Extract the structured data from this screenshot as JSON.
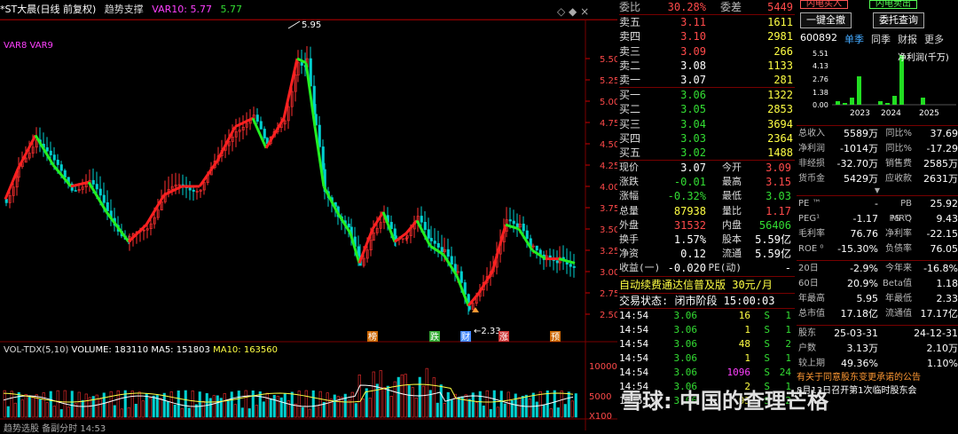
{
  "chart": {
    "title": "*ST大晨(日线 前复权)",
    "indicator_name": "趋势支撑",
    "var10": "VAR10: 5.77",
    "var10b": "5.77",
    "var8": "VAR8",
    "var9": "VAR9",
    "high_label": "5.95",
    "low_label": "2.33",
    "price_ticks": [
      "5.50",
      "5.25",
      "5.00",
      "4.75",
      "4.50",
      "4.25",
      "4.00",
      "3.75",
      "3.50",
      "3.25",
      "3.00",
      "2.75",
      "2.50"
    ],
    "markers": [
      "榜",
      "跌",
      "财",
      "涨",
      "预"
    ],
    "vol_header": {
      "name": "VOL-TDX(5,10)",
      "volume": "VOLUME: 183110",
      "ma5": "MA5: 151803",
      "ma10": "MA10: 163560"
    },
    "vol_ticks": [
      "10000",
      "5000",
      "X100"
    ],
    "bottom_text": "趋势选股   备副分时  14:53"
  },
  "order_book": {
    "ratio_label": "委比",
    "ratio_value": "30.28%",
    "diff_label": "委差",
    "diff_value": "5449",
    "asks": [
      {
        "label": "卖五",
        "price": "3.11",
        "vol": "1611"
      },
      {
        "label": "卖四",
        "price": "3.10",
        "vol": "2981"
      },
      {
        "label": "卖三",
        "price": "3.09",
        "vol": "266"
      },
      {
        "label": "卖二",
        "price": "3.08",
        "vol": "1133"
      },
      {
        "label": "卖一",
        "price": "3.07",
        "vol": "281"
      }
    ],
    "bids": [
      {
        "label": "买一",
        "price": "3.06",
        "vol": "1322"
      },
      {
        "label": "买二",
        "price": "3.05",
        "vol": "2853"
      },
      {
        "label": "买三",
        "price": "3.04",
        "vol": "3694"
      },
      {
        "label": "买四",
        "price": "3.03",
        "vol": "2364"
      },
      {
        "label": "买五",
        "price": "3.02",
        "vol": "1488"
      }
    ],
    "stats": [
      {
        "k1": "现价",
        "v1": "3.07",
        "k2": "今开",
        "v2": "3.09"
      },
      {
        "k1": "涨跌",
        "v1": "-0.01",
        "k2": "最高",
        "v2": "3.15"
      },
      {
        "k1": "涨幅",
        "v1": "-0.32%",
        "k2": "最低",
        "v2": "3.03"
      },
      {
        "k1": "总量",
        "v1": "87938",
        "k2": "量比",
        "v2": "1.17"
      },
      {
        "k1": "外盘",
        "v1": "31532",
        "k2": "内盘",
        "v2": "56406"
      },
      {
        "k1": "换手",
        "v1": "1.57%",
        "k2": "股本",
        "v2": "5.59亿"
      },
      {
        "k1": "净资",
        "v1": "0.12",
        "k2": "流通",
        "v2": "5.59亿"
      },
      {
        "k1": "收益(一)",
        "v1": "-0.020",
        "k2": "PE(动)",
        "v2": "-"
      }
    ],
    "ad_text": "自动续费通达信普及版  30元/月",
    "trade_status": "交易状态: 闭市阶段 15:00:03",
    "trades": [
      {
        "time": "14:54",
        "price": "3.06",
        "vol": "16",
        "side": "S",
        "n": "1"
      },
      {
        "time": "14:54",
        "price": "3.06",
        "vol": "1",
        "side": "S",
        "n": "1"
      },
      {
        "time": "14:54",
        "price": "3.06",
        "vol": "48",
        "side": "S",
        "n": "2"
      },
      {
        "time": "14:54",
        "price": "3.06",
        "vol": "1",
        "side": "S",
        "n": "1"
      },
      {
        "time": "14:54",
        "price": "3.06",
        "vol": "1096",
        "side": "S",
        "n": "24"
      },
      {
        "time": "14:54",
        "price": "3.06",
        "vol": "2",
        "side": "S",
        "n": "1"
      },
      {
        "time": "14:55",
        "price": "3.06",
        "vol": "93",
        "side": "S",
        "n": "2"
      }
    ]
  },
  "fin": {
    "btn1": "一键全撤",
    "btn2": "委托查询",
    "top_btn1": "闪电买入",
    "top_btn2": "闪电卖出",
    "code": "600892",
    "tabs": [
      "单季",
      "同季",
      "财报",
      "更多"
    ],
    "bar_title": "净利润(千万)",
    "bar_ticks": [
      "5.51",
      "4.13",
      "2.76",
      "1.38",
      "0.00"
    ],
    "bar_years": [
      "2023",
      "2024",
      "2025"
    ],
    "rows1": [
      {
        "k": "总收入",
        "v": "5589万",
        "k2": "同比%",
        "v2": "37.69"
      },
      {
        "k": "净利润",
        "v": "-1014万",
        "k2": "同比%",
        "v2": "-17.29"
      },
      {
        "k": "非经损",
        "v": "-32.70万",
        "k2": "销售费",
        "v2": "2585万"
      },
      {
        "k": "货币金",
        "v": "5429万",
        "k2": "应收款",
        "v2": "2631万"
      }
    ],
    "rows2": [
      {
        "k": "PE ™",
        "v": "-",
        "k2": "PB MRQ",
        "v2": "25.92"
      },
      {
        "k": "PEG¹",
        "v": "-1.17",
        "k2": "PS ™",
        "v2": "9.43"
      },
      {
        "k": "毛利率",
        "v": "76.76",
        "k2": "净利率",
        "v2": "-22.15"
      },
      {
        "k": "ROE ⁰",
        "v": "-15.30%",
        "k2": "负债率",
        "v2": "76.05"
      }
    ],
    "rows3": [
      {
        "k": "20日",
        "v": "-2.9%",
        "k2": "今年来",
        "v2": "-16.8%"
      },
      {
        "k": "60日",
        "v": "20.9%",
        "k2": "Beta值",
        "v2": "1.18"
      },
      {
        "k": "年最高",
        "v": "5.95",
        "k2": "年最低",
        "v2": "2.33"
      },
      {
        "k": "总市值",
        "v": "17.18亿",
        "k2": "流通值",
        "v2": "17.17亿"
      }
    ],
    "rows4": [
      {
        "k": "股东",
        "v": "25-03-31",
        "k2": "",
        "v2": "24-12-31"
      },
      {
        "k": "户数",
        "v": "3.13万",
        "k2": "",
        "v2": "2.10万"
      },
      {
        "k": "较上期",
        "v": "49.36%",
        "k2": "",
        "v2": "1.10%"
      }
    ],
    "news1": "有关于同意股东变更承诺的公告",
    "news2": "8月13日召开第1次临时股东会"
  },
  "watermark": "雪球: 中国的查理芒格",
  "colors": {
    "up": "#ff3030",
    "down": "#00d0d0",
    "line_up": "#ff2020",
    "line_down": "#22ee22",
    "grid": "#7a0000"
  }
}
